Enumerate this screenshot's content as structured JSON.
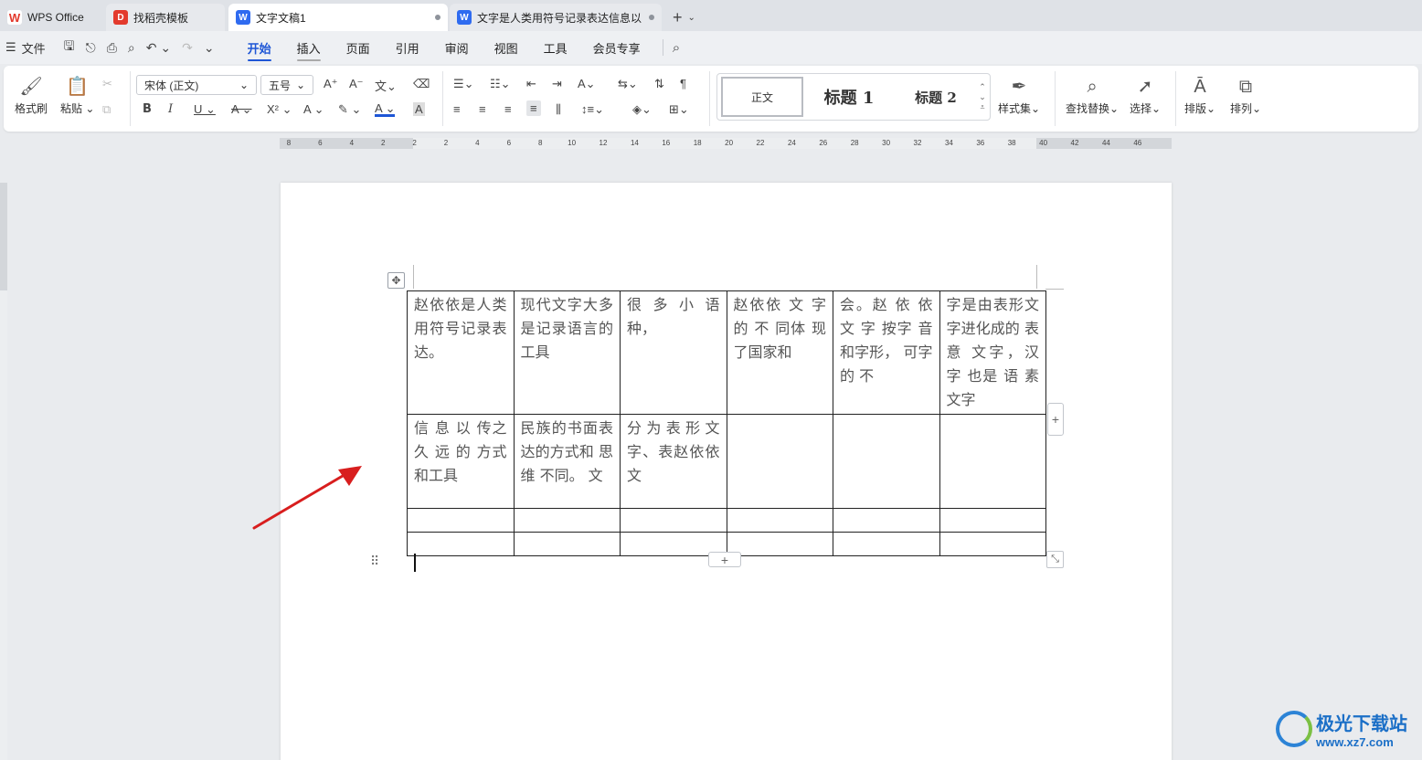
{
  "tabs": [
    {
      "label": "WPS Office",
      "icon": "wps-logo-icon",
      "color": "#e33a2d"
    },
    {
      "label": "找稻壳模板",
      "icon": "docer-icon",
      "color": "#e33a2d"
    },
    {
      "label": "文字文稿1",
      "icon": "writer-doc-icon",
      "color": "#2f6bf0"
    },
    {
      "label": "文字是人类用符号记录表达信息以",
      "icon": "writer-doc-icon",
      "color": "#2f6bf0"
    }
  ],
  "menu": {
    "file_label": "文件",
    "items": [
      "开始",
      "插入",
      "页面",
      "引用",
      "审阅",
      "视图",
      "工具",
      "会员专享"
    ],
    "active": "开始"
  },
  "ribbon": {
    "format_painter": "格式刷",
    "paste": "粘贴",
    "font_name": "宋体 (正文)",
    "font_size": "五号",
    "styles": [
      "正文",
      "标题 1",
      "标题 2"
    ],
    "style_set": "样式集",
    "find_replace": "查找替换",
    "select": "选择",
    "layout": "排版",
    "arrange": "排列"
  },
  "ruler": {
    "labels": [
      "8",
      "6",
      "4",
      "2",
      "2",
      "2",
      "4",
      "6",
      "8",
      "10",
      "12",
      "14",
      "16",
      "18",
      "20",
      "22",
      "24",
      "26",
      "28",
      "30",
      "32",
      "34",
      "36",
      "38",
      "40",
      "42",
      "44",
      "46"
    ]
  },
  "table": {
    "rows": [
      [
        "赵依依是人类用符号记录表达。",
        "现代文字大多是记录语言的工具",
        "很 多 小 语种，",
        "赵依依 文 字的 不 同体 现了国家和",
        "会。赵 依 依文 字 按字 音和字形， 可字 的 不",
        "字是由表形文字进化成的 表 意 文字，汉 字 也是 语 素文字"
      ],
      [
        "信 息 以 传之久 远 的 方式和工具",
        "民族的书面表达的方式和 思 维 不同。 文",
        "分为表形文字、表赵依依 文",
        "",
        "",
        ""
      ],
      [
        "",
        "",
        "",
        "",
        "",
        ""
      ],
      [
        "",
        "",
        "",
        "",
        "",
        ""
      ]
    ]
  },
  "watermark": {
    "title": "极光下载站",
    "url": "www.xz7.com"
  },
  "colors": {
    "accent": "#1e56d6",
    "arrow": "#e02020"
  }
}
